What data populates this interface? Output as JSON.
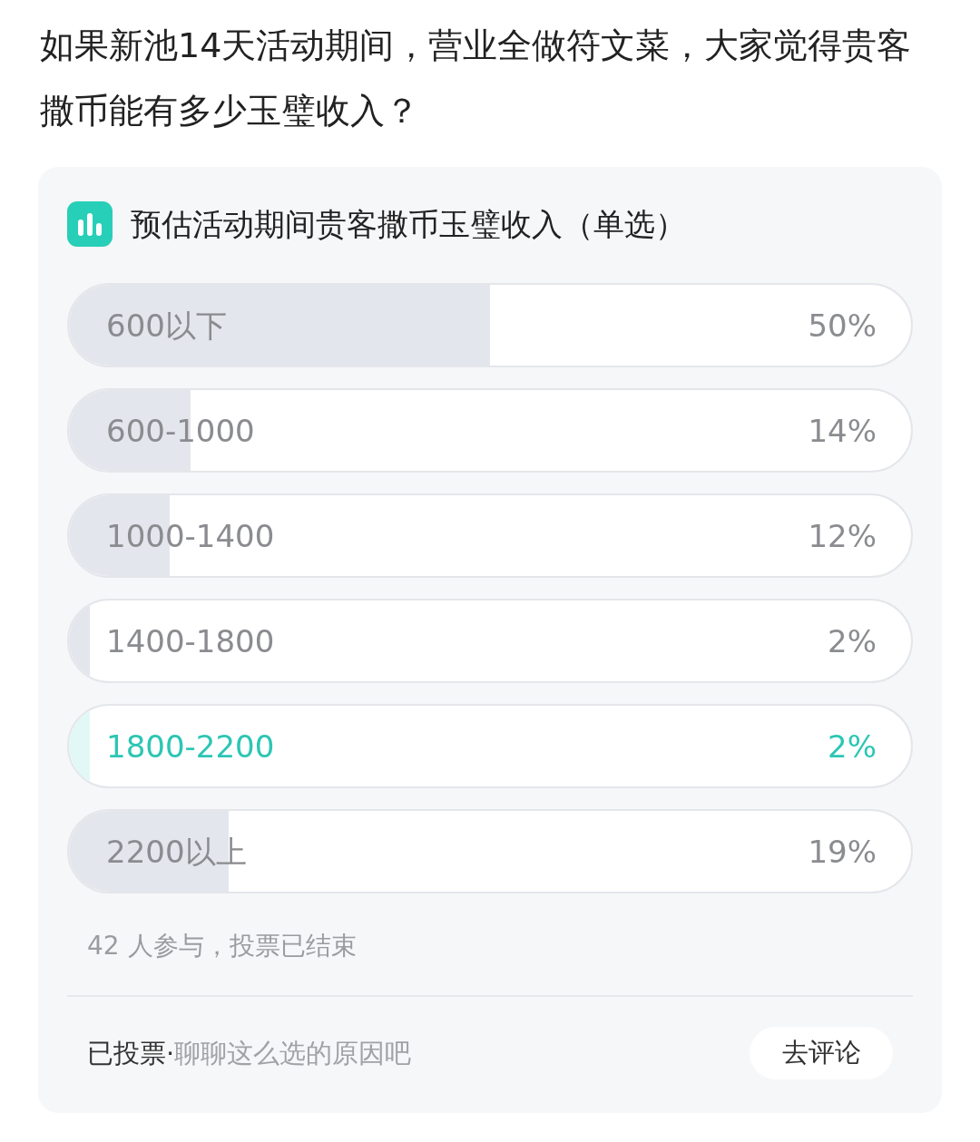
{
  "question": "如果新池14天活动期间，营业全做符文菜，大家觉得贵客撒币能有多少玉璧收入？",
  "poll": {
    "title": "预估活动期间贵客撒币玉璧收入（单选）",
    "options": [
      {
        "label": "600以下",
        "percent": "50%",
        "level": 0.5,
        "selected": false
      },
      {
        "label": "600-1000",
        "percent": "14%",
        "level": 0.144,
        "selected": false
      },
      {
        "label": "1000-1400",
        "percent": "12%",
        "level": 0.12,
        "selected": false
      },
      {
        "label": "1400-1800",
        "percent": "2%",
        "level": 0.025,
        "selected": false
      },
      {
        "label": "1800-2200",
        "percent": "2%",
        "level": 0.025,
        "selected": true
      },
      {
        "label": "2200以上",
        "percent": "19%",
        "level": 0.19,
        "selected": false
      }
    ],
    "participation": "42 人参与，投票已结束",
    "vote_status": "已投票·",
    "comment_prompt": "聊聊这么选的原因吧",
    "comment_button": "去评论"
  }
}
